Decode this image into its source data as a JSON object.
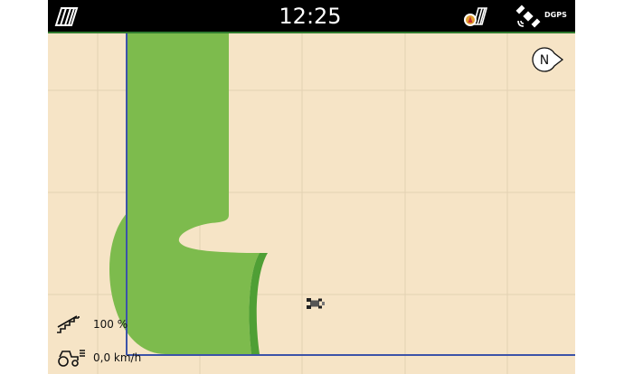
{
  "status_bar": {
    "time": "12:25",
    "gps_label": "DGPS",
    "left_icon": "field-stripes-icon",
    "mid_icon": "implement-status-icon",
    "right_icon": "satellite-icon"
  },
  "map": {
    "compass_label": "N",
    "vehicle_icon": "tractor-icon"
  },
  "status_panel": {
    "coverage_value": "100 %",
    "speed_value": "0,0 km/h"
  },
  "colors": {
    "field": "#f6e4c6",
    "coverage": "#7dbb4d",
    "coverage_edge": "#4f9f35",
    "boundary": "#3c53a8",
    "topbar": "#000000"
  }
}
